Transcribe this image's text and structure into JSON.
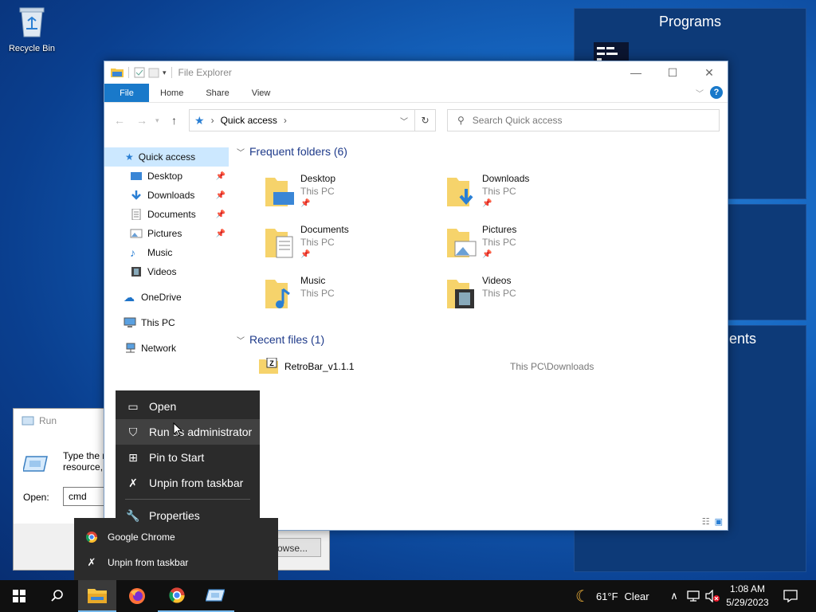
{
  "desktop": {
    "recycle_bin_label": "Recycle Bin",
    "panel_programs_title": "Programs",
    "panel_partial_title": "ents"
  },
  "run_dialog": {
    "title": "Run",
    "description_line1": "Type the n",
    "description_line2": "resource,",
    "open_label": "Open:",
    "open_value": "cmd",
    "browse_label": "owse..."
  },
  "explorer": {
    "title": "File Explorer",
    "tabs": [
      "File",
      "Home",
      "Share",
      "View"
    ],
    "address": "Quick access",
    "search_placeholder": "Search Quick access",
    "nav": [
      {
        "label": "Quick access",
        "selected": true,
        "pinned": false
      },
      {
        "label": "Desktop",
        "pinned": true
      },
      {
        "label": "Downloads",
        "pinned": true
      },
      {
        "label": "Documents",
        "pinned": true
      },
      {
        "label": "Pictures",
        "pinned": true
      },
      {
        "label": "Music",
        "pinned": false
      },
      {
        "label": "Videos",
        "pinned": false
      },
      {
        "label": "OneDrive",
        "pinned": false
      },
      {
        "label": "This PC",
        "pinned": false
      },
      {
        "label": "Network",
        "pinned": false
      }
    ],
    "frequent_header": "Frequent folders (6)",
    "folders": [
      {
        "name": "Desktop",
        "location": "This PC",
        "pinned": true
      },
      {
        "name": "Downloads",
        "location": "This PC",
        "pinned": true
      },
      {
        "name": "Documents",
        "location": "This PC",
        "pinned": true
      },
      {
        "name": "Pictures",
        "location": "This PC",
        "pinned": true
      },
      {
        "name": "Music",
        "location": "This PC",
        "pinned": false
      },
      {
        "name": "Videos",
        "location": "This PC",
        "pinned": false
      }
    ],
    "recent_header": "Recent files (1)",
    "recent_files": [
      {
        "name": "RetroBar_v1.1.1",
        "path": "This PC\\Downloads"
      }
    ]
  },
  "context_menu": {
    "items": [
      "Open",
      "Run as administrator",
      "Pin to Start",
      "Unpin from taskbar",
      "Properties"
    ],
    "highlighted": "Run as administrator"
  },
  "jump_list": {
    "items": [
      "Google Chrome",
      "Unpin from taskbar"
    ]
  },
  "taskbar": {
    "weather_temp": "61°F",
    "weather_desc": "Clear",
    "time": "1:08 AM",
    "date": "5/29/2023"
  },
  "colors": {
    "accent": "#1979ca",
    "menu_bg": "#2b2b2b",
    "taskbar_bg": "#101010"
  }
}
